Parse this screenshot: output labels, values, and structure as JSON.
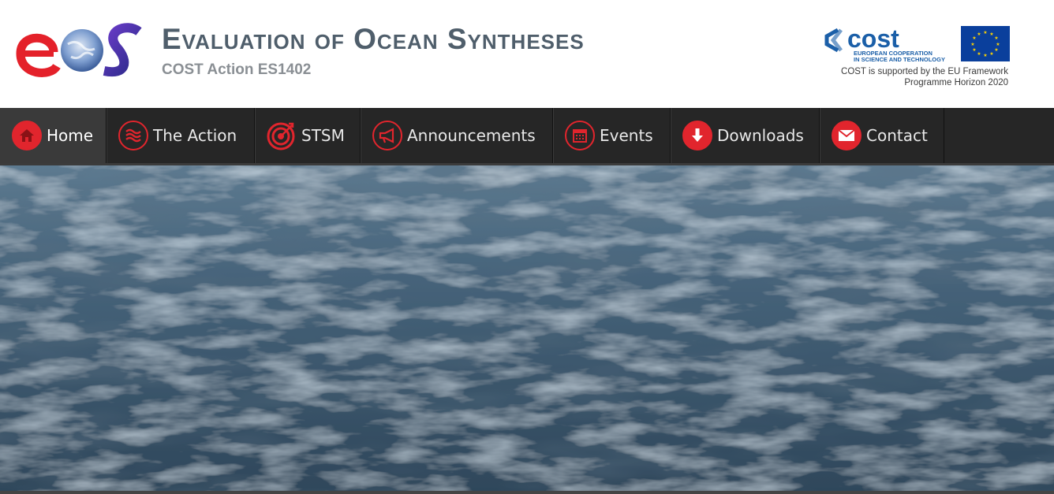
{
  "header": {
    "logo_text": "eos",
    "title": "Evaluation of Ocean Syntheses",
    "subtitle": "COST Action ES1402",
    "cost_logo_text": "cost",
    "cost_tagline_line1": "EUROPEAN COOPERATION",
    "cost_tagline_line2": "IN SCIENCE AND TECHNOLOGY",
    "cost_note_line1": "COST is supported by the EU Framework",
    "cost_note_line2": "Programme Horizon 2020"
  },
  "nav": {
    "items": [
      {
        "label": "Home",
        "icon": "home-icon"
      },
      {
        "label": "The Action",
        "icon": "waves-icon"
      },
      {
        "label": "STSM",
        "icon": "target-icon"
      },
      {
        "label": "Announcements",
        "icon": "megaphone-icon"
      },
      {
        "label": "Events",
        "icon": "calendar-icon"
      },
      {
        "label": "Downloads",
        "icon": "download-icon"
      },
      {
        "label": "Contact",
        "icon": "envelope-icon"
      }
    ],
    "active_index": 0
  },
  "hero": {
    "image": "ocean-water-surface"
  },
  "colors": {
    "nav_background": "#262626",
    "icon_accent": "#e1252d",
    "title_color": "#4f5e6b",
    "cost_blue": "#1b5fa8",
    "eu_blue": "#0a3f9c",
    "eu_star": "#ffd400"
  }
}
